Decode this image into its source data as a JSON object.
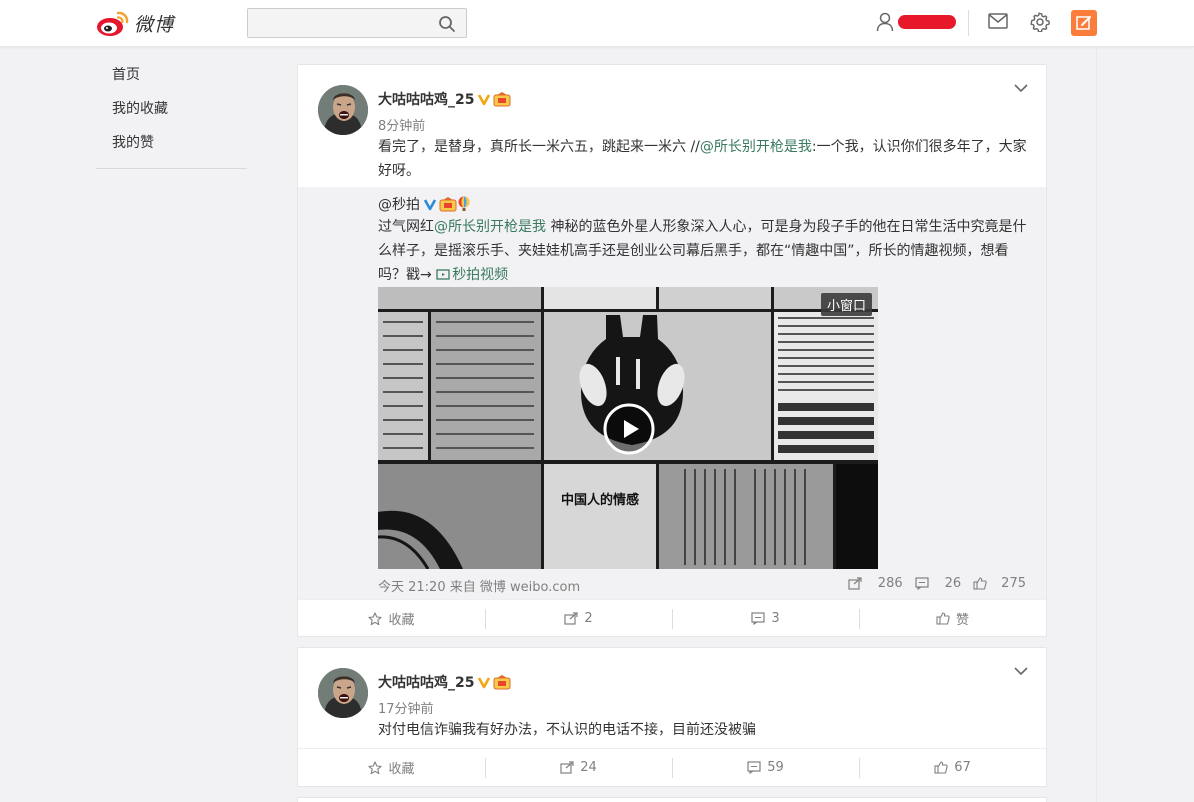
{
  "header": {
    "logo_text": "微博",
    "search_placeholder": "",
    "brand_color": "#e6162d",
    "accent_color": "#fa7d3c",
    "icons": [
      "weibo-logo-icon",
      "search-icon",
      "user-icon",
      "mail-icon",
      "gear-icon",
      "compose-icon"
    ]
  },
  "sidebar": {
    "items": [
      {
        "label": "首页"
      },
      {
        "label": "我的收藏"
      },
      {
        "label": "我的赞"
      }
    ]
  },
  "feed": [
    {
      "author": "大咕咕咕鸡_25",
      "time": "8分钟前",
      "text_before": "看完了，是替身，真所长一米六五，跳起来一米六 //",
      "mention": "@所长别开枪是我",
      "text_after": ":一个我，认识你们很多年了，大家好呀。",
      "repost": {
        "author": "@秒拍",
        "text_before": "过气网红",
        "mention": "@所长别开枪是我",
        "text_after": " 神秘的蓝色外星人形象深入人心，可是身为段子手的他在日常生活中究竟是什么样子，是摇滚乐手、夹娃娃机高手还是创业公司幕后黑手，都在“情趣中国”，所长的情趣视频，想看吗？戳→ ",
        "video_link": "秒拍视频",
        "mini_window_label": "小窗口",
        "video_caption": "中国人的情感",
        "footer": "今天 21:20 来自 微博 weibo.com",
        "shares": "286",
        "comments": "26",
        "likes": "275"
      },
      "actions": {
        "favorite": "收藏",
        "reposts": "2",
        "comments": "3",
        "like": "赞"
      }
    },
    {
      "author": "大咕咕咕鸡_25",
      "time": "17分钟前",
      "text": "对付电信诈骗我有好办法，不认识的电话不接，目前还没被骗",
      "actions": {
        "favorite": "收藏",
        "reposts": "24",
        "comments": "59",
        "like": "67"
      }
    }
  ]
}
